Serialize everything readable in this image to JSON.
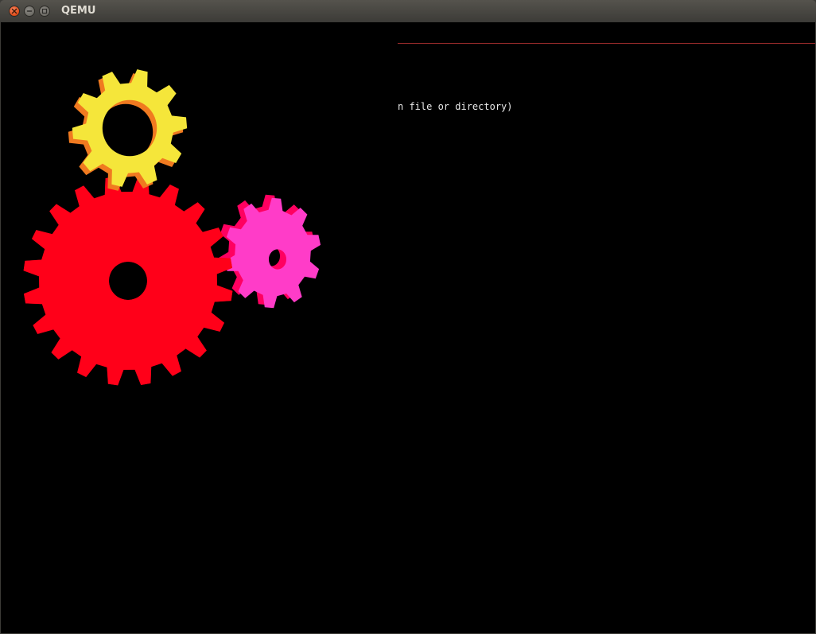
{
  "window": {
    "title": "QEMU"
  },
  "console": {
    "text_fragment": "n file or directory)"
  },
  "gears": [
    {
      "name": "yellow-gear",
      "color": "#f5e63a",
      "side_color": "#f07a20"
    },
    {
      "name": "red-gear",
      "color": "#ff0019",
      "side_color": "#c00010"
    },
    {
      "name": "pink-gear",
      "color": "#ff3cc8",
      "side_color": "#ff0060"
    }
  ]
}
